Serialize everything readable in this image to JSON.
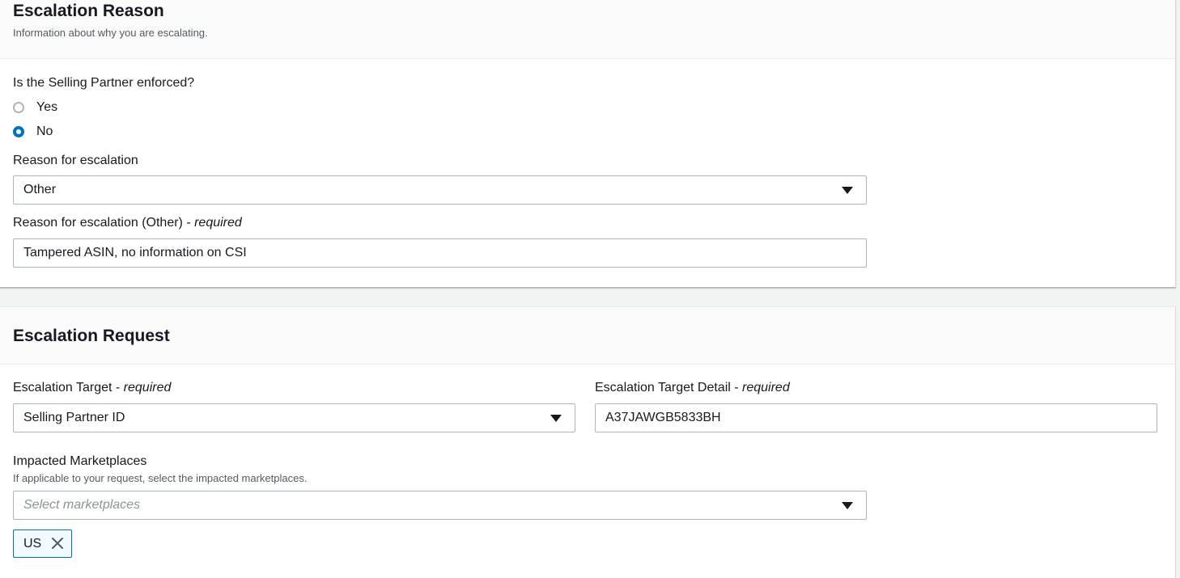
{
  "reason_panel": {
    "title": "Escalation Reason",
    "description": "Information about why you are escalating.",
    "enforced_question": "Is the Selling Partner enforced?",
    "enforced_options": [
      {
        "label": "Yes",
        "checked": false
      },
      {
        "label": "No",
        "checked": true
      }
    ],
    "reason_label": "Reason for escalation",
    "reason_value": "Other",
    "other_label": "Reason for escalation (Other)",
    "other_required": "required",
    "other_value": "Tampered ASIN, no information on CSI"
  },
  "request_panel": {
    "title": "Escalation Request",
    "target_label": "Escalation Target",
    "target_required": "required",
    "target_value": "Selling Partner ID",
    "target_detail_label": "Escalation Target Detail",
    "target_detail_required": "required",
    "target_detail_value": "A37JAWGB5833BH",
    "marketplaces_label": "Impacted Marketplaces",
    "marketplaces_description": "If applicable to your request, select the impacted marketplaces.",
    "marketplaces_placeholder": "Select marketplaces",
    "selected_marketplaces": [
      "US"
    ]
  },
  "colors": {
    "accent": "#0073bb",
    "token_bg": "#f1faff",
    "page_bg": "#f2f3f3"
  },
  "icons": {
    "dropdown": "caret-down-icon",
    "remove_token": "close-icon"
  }
}
